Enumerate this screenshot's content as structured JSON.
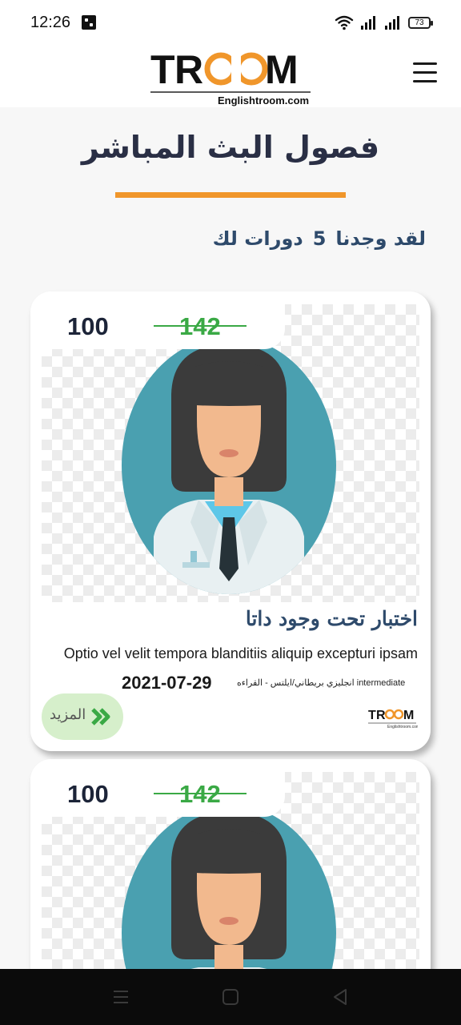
{
  "status_bar": {
    "time": "12:26",
    "battery": "73",
    "icons": [
      "notification-icon",
      "wifi-icon",
      "signal-icon",
      "signal-icon",
      "battery-icon"
    ]
  },
  "header": {
    "logo_letters": [
      "T",
      "R",
      "O",
      "O",
      "M"
    ],
    "logo_domain": "Englishtroom.com",
    "menu_icon": "hamburger-menu-icon"
  },
  "page": {
    "title": "فصول البث المباشر",
    "results_prefix": "لقد وجدنا",
    "results_count": "5",
    "results_suffix": "دورات لك"
  },
  "courses": [
    {
      "price": "100",
      "old_price": "142",
      "title": "اختبار تحت وجود داتا",
      "description": "Optio vel velit tempora blanditiis aliquip excepturi ipsam",
      "date": "2021-07-29",
      "level": "انجليزي بريطاني/ايلتس - القراءه intermediate",
      "more_label": "المزيد",
      "image": "teacher-avatar"
    },
    {
      "price": "100",
      "old_price": "142",
      "image": "teacher-avatar"
    }
  ],
  "colors": {
    "accent_orange": "#f0962b",
    "heading_navy": "#2e4a6b",
    "price_green": "#3aa945",
    "avatar_teal": "#4aa0b0",
    "more_button_bg": "#d6efcb",
    "nav_bar": "#0b0b0b"
  },
  "navigation_bar": {
    "buttons": [
      "recent-apps-icon",
      "home-icon",
      "back-icon"
    ]
  }
}
